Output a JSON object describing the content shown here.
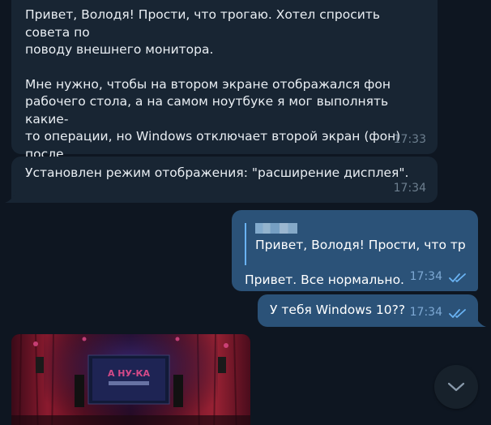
{
  "messages": [
    {
      "direction": "incoming",
      "paragraphs": [
        "Привет, Володя! Прости, что трогаю. Хотел спросить совета по\nповоду внешнего монитора.",
        "Мне нужно, чтобы на втором экране отображался фон\nрабочего стола, а на самом ноутбуке я мог выполнять какие-\nто операции, но Windows отключает второй экран (фон) после\nтого как я открою любое окно или меню на первом экране."
      ],
      "time": "17:33"
    },
    {
      "direction": "incoming",
      "text": "Установлен режим отображения: \"расширение дисплея\".",
      "time": "17:34"
    },
    {
      "direction": "outgoing",
      "reply_preview": "Привет, Володя! Прости, что тр...",
      "text": "Привет. Все нормально.",
      "time": "17:34",
      "status": "read"
    },
    {
      "direction": "outgoing",
      "text": "У тебя Windows 10??",
      "time": "17:34",
      "status": "read"
    }
  ],
  "photo": {
    "screen_text": "А НУ-КА"
  },
  "icons": {
    "read_checks": "double-check-icon",
    "scroll_down": "chevron-down-icon"
  },
  "colors": {
    "background": "#0e1621",
    "incoming_bubble": "#182533",
    "outgoing_bubble": "#2b5278",
    "accent": "#6ab3f3"
  }
}
